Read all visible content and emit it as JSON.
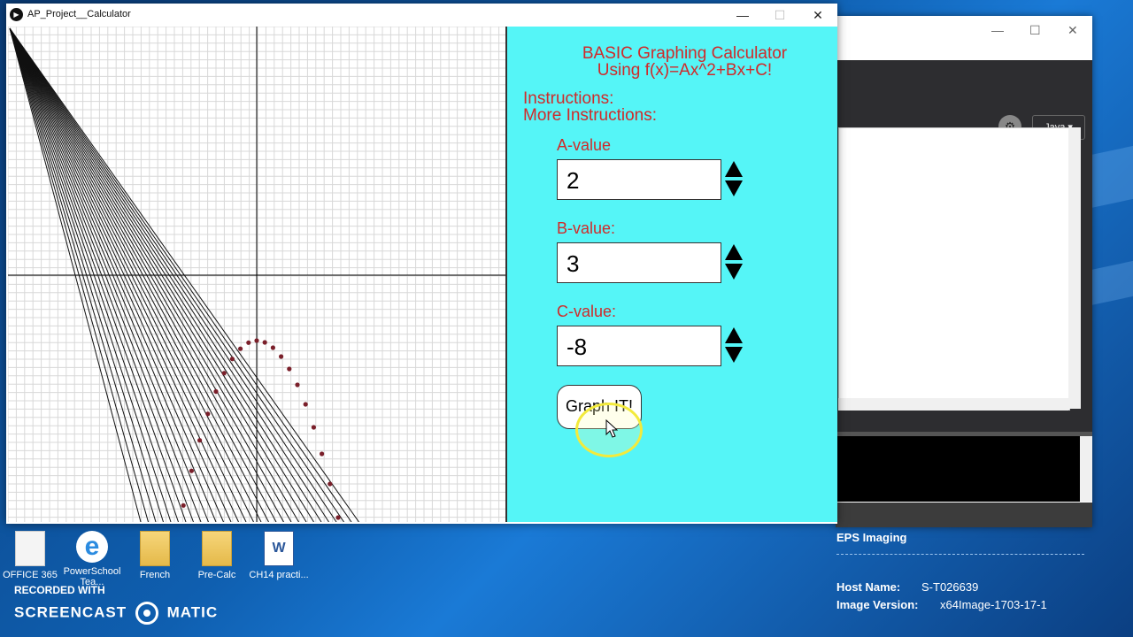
{
  "main_window": {
    "title": "AP_Project__Calculator",
    "controls": {
      "minimize": "—",
      "maximize": "☐",
      "close": "✕"
    }
  },
  "panel": {
    "title_line1": "BASIC Graphing Calculator",
    "title_line2": "Using f(x)=Ax^2+Bx+C!",
    "instructions": "Instructions:",
    "more_instructions": "More Instructions:",
    "a_label": "A-value",
    "a_value": "2",
    "b_label": "B-value:",
    "b_value": "3",
    "c_label": "C-value:",
    "c_value": "-8",
    "graph_button": "Graph IT!"
  },
  "back_window": {
    "controls": {
      "minimize": "—",
      "maximize": "☐",
      "close": "✕"
    },
    "language_button": "Java ▾"
  },
  "info": {
    "title": "EPS Imaging",
    "host_label": "Host Name:",
    "host_value": "S-T026639",
    "image_label": "Image Version:",
    "image_value": "x64Image-1703-17-1"
  },
  "desktop_icons": [
    {
      "label": "OFFICE 365",
      "icon": "document-icon"
    },
    {
      "label": "PowerSchool Tea...",
      "icon": "internet-explorer-icon"
    },
    {
      "label": "French",
      "icon": "folder-icon"
    },
    {
      "label": "Pre-Calc",
      "icon": "folder-icon"
    },
    {
      "label": "CH14 practi...",
      "icon": "word-document-icon"
    }
  ],
  "recording": {
    "line1": "RECORDED WITH",
    "brand_left": "SCREENCAST",
    "brand_right": "MATIC"
  }
}
